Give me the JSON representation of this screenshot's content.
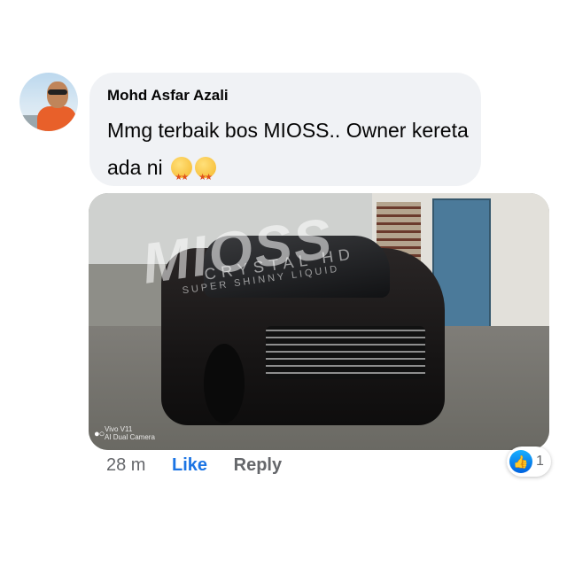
{
  "comment": {
    "author": "Mohd Asfar Azali",
    "text": "Mmg terbaik bos MIOSS.. Owner kereta ada ni",
    "emojis": [
      "star-struck-emoji",
      "star-struck-emoji"
    ]
  },
  "photo": {
    "watermark_main": "MIOSS",
    "watermark_sub": "CRYSTAL HD",
    "watermark_sub2": "SUPER SHINNY LIQUID",
    "camera_line1": "Vivo V11",
    "camera_line2": "AI Dual Camera"
  },
  "actions": {
    "time": "28 m",
    "like_label": "Like",
    "reply_label": "Reply"
  },
  "reactions": {
    "icon": "thumbs-up-icon",
    "count": "1",
    "color": "#1b74e4"
  }
}
